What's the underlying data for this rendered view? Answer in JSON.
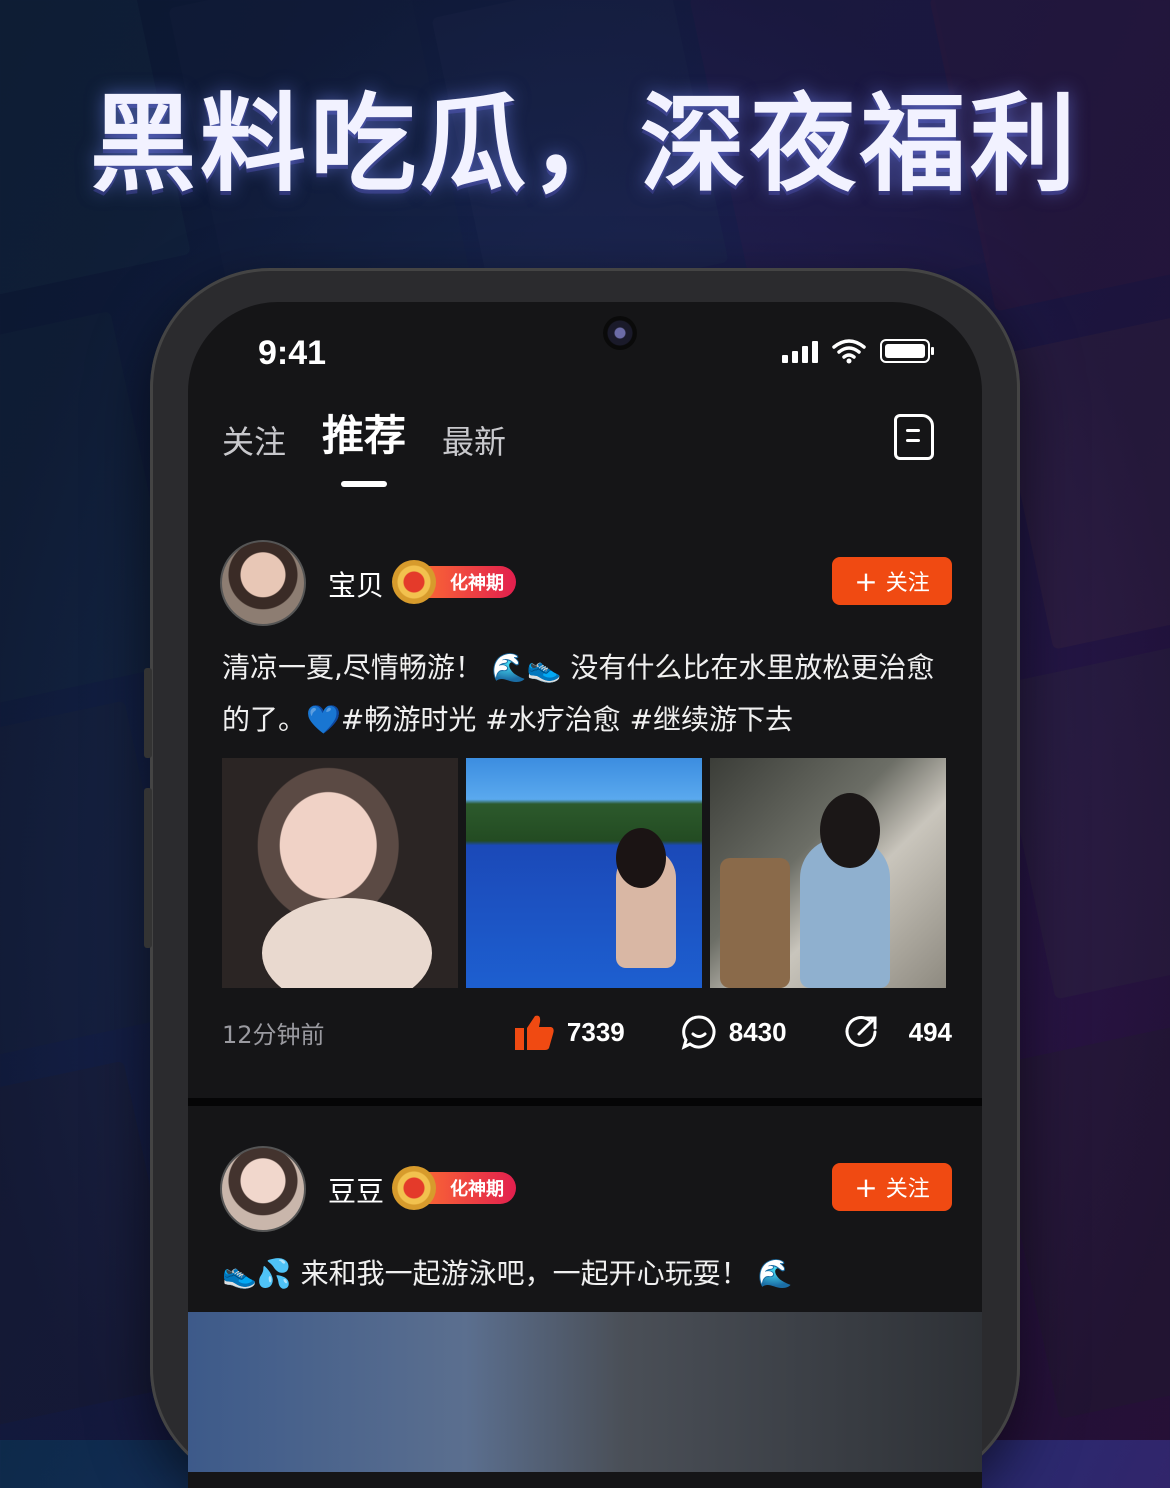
{
  "headline": "黑料吃瓜，深夜福利",
  "status_bar": {
    "time": "9:41"
  },
  "tabs": [
    "关注",
    "推荐",
    "最新"
  ],
  "active_tab": "推荐",
  "posts": [
    {
      "username": "宝贝",
      "badge": "化神期",
      "follow_label": "关注",
      "text": "清凉一夏,尽情畅游！ 🌊👟 没有什么比在水里放松更治愈的了。💙#畅游时光 #水疗治愈 #继续游下去",
      "images": [
        "selfie-portrait",
        "pool-swim",
        "lounge-sofa"
      ],
      "time": "12分钟前",
      "likes": "7339",
      "comments": "8430",
      "shares": "494"
    },
    {
      "username": "豆豆",
      "badge": "化神期",
      "follow_label": "关注",
      "text": "👟💦 来和我一起游泳吧，一起开心玩耍！ 🌊"
    }
  ],
  "colors": {
    "accent": "#f04a12",
    "badge_start": "#ff7a2e",
    "badge_end": "#e21f4e",
    "screen_bg": "#151517"
  }
}
